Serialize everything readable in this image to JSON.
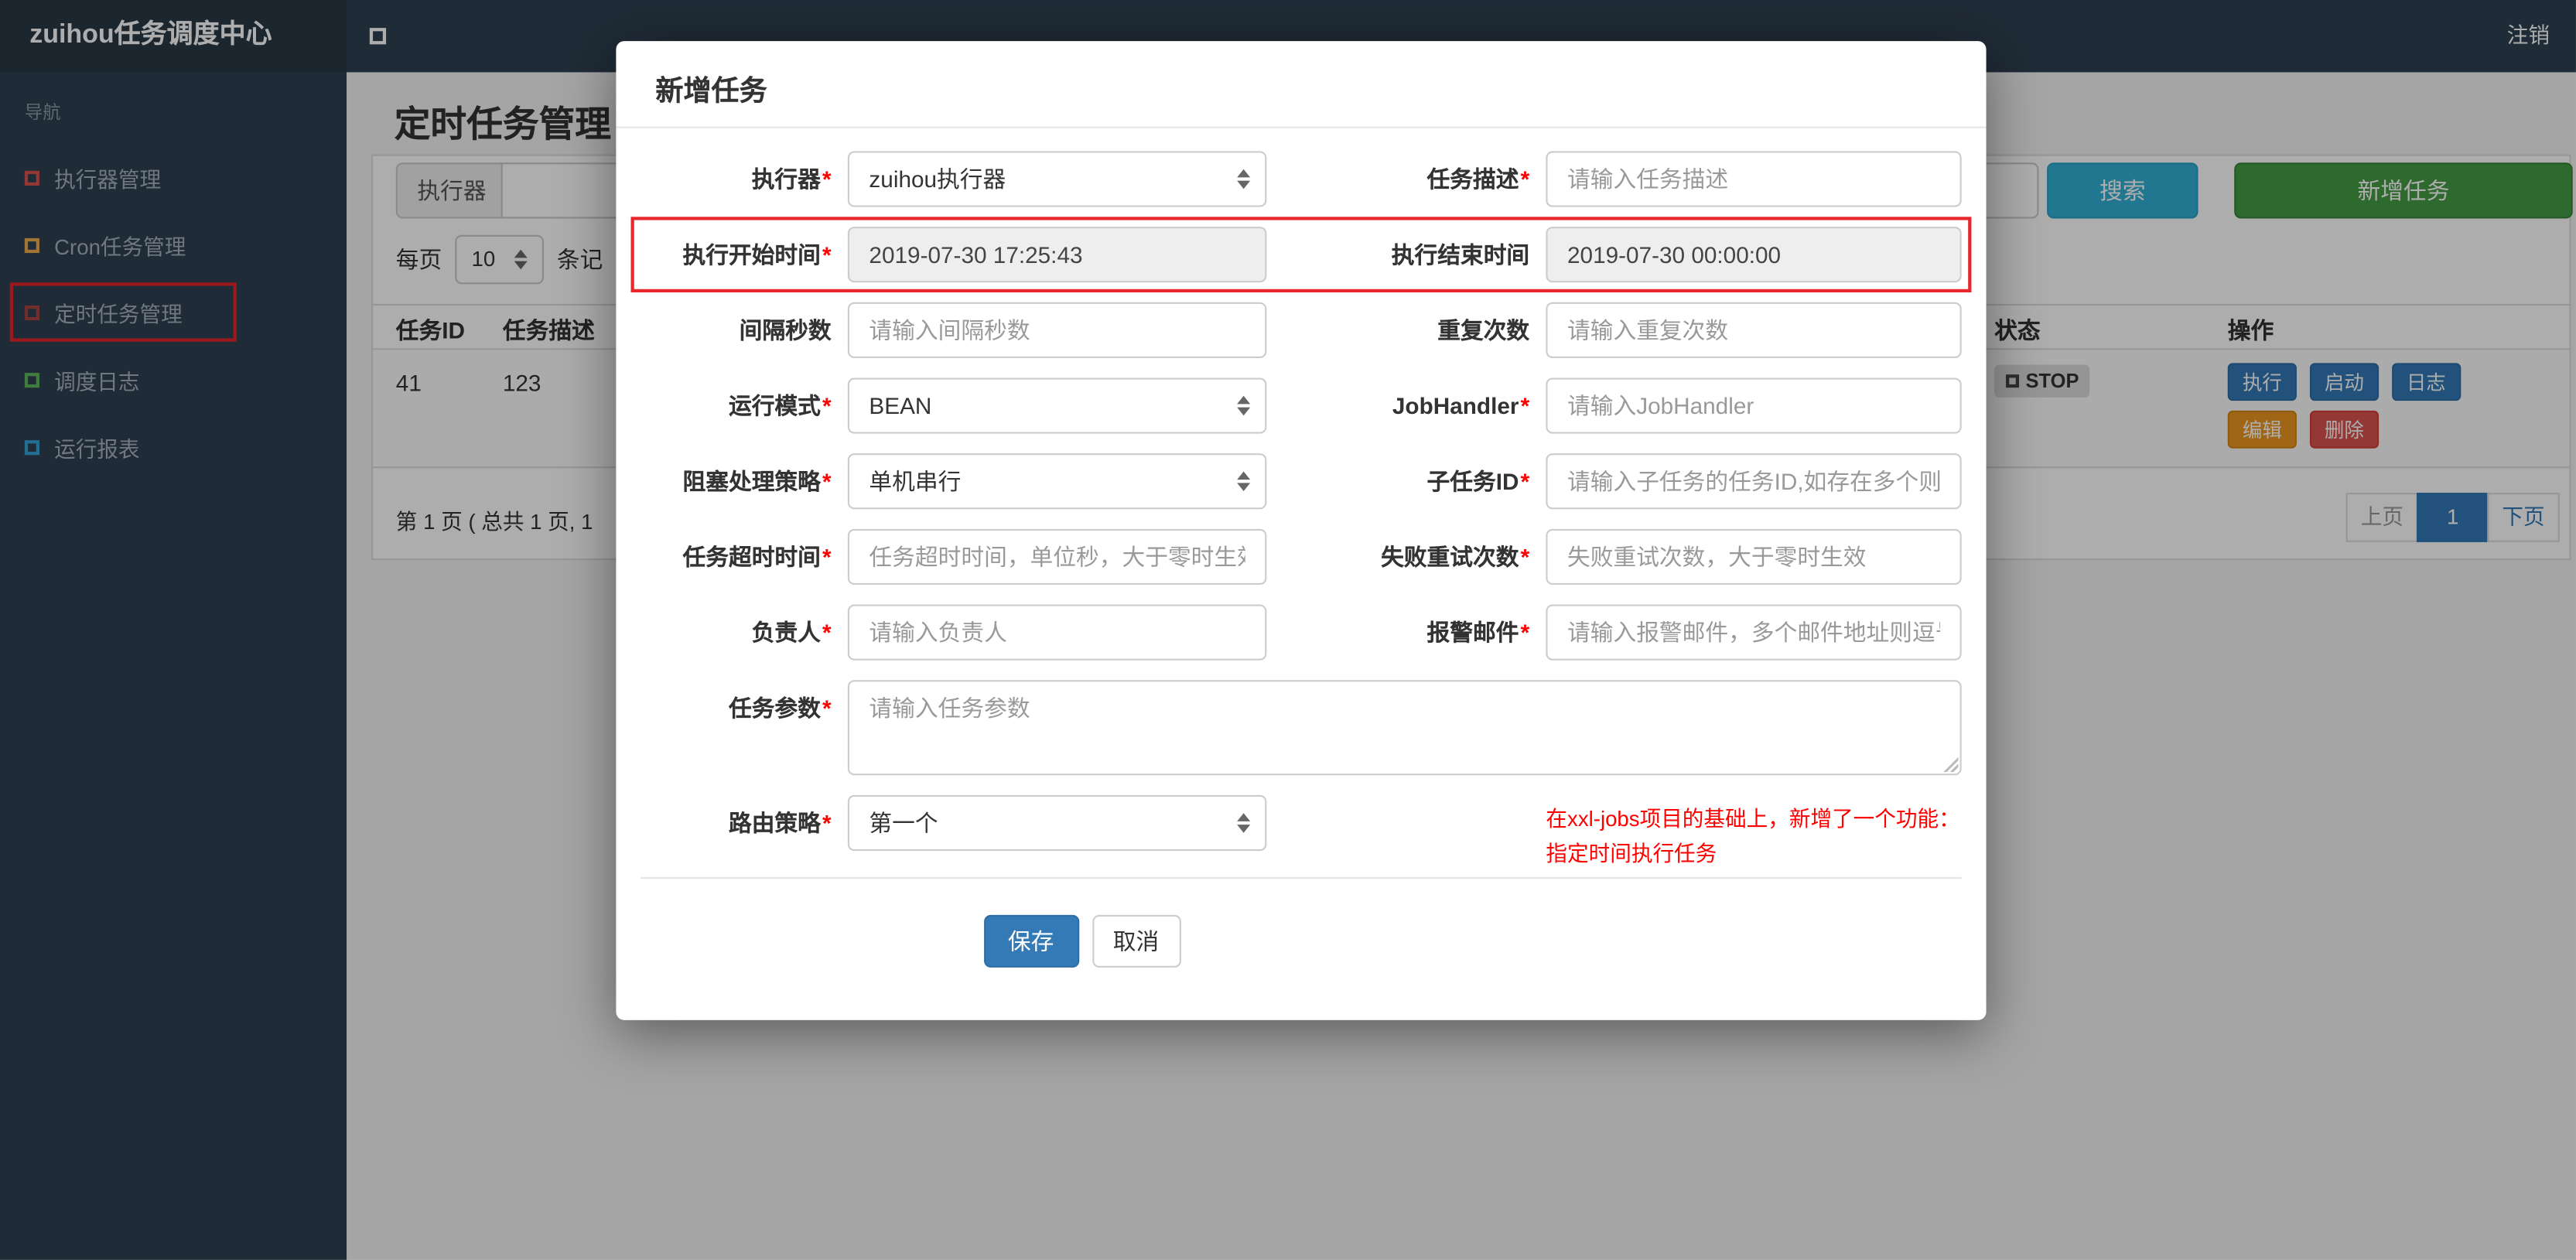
{
  "navbar": {
    "brand": "zuihou任务调度中心",
    "logout_label": "注销"
  },
  "sidebar": {
    "section_header": "导航",
    "items": [
      {
        "label": "执行器管理",
        "icon": "square-outline-icon",
        "icon_color": "#d9534f",
        "annotated": false
      },
      {
        "label": "Cron任务管理",
        "icon": "square-outline-icon",
        "icon_color": "#f0ad4e",
        "annotated": false
      },
      {
        "label": "定时任务管理",
        "icon": "square-outline-icon",
        "icon_color": "#a94442",
        "annotated": true
      },
      {
        "label": "调度日志",
        "icon": "square-outline-icon",
        "icon_color": "#5cb85c",
        "annotated": false
      },
      {
        "label": "运行报表",
        "icon": "square-outline-icon",
        "icon_color": "#36a3d9",
        "annotated": false
      }
    ]
  },
  "page": {
    "title": "定时任务管理",
    "toolbar": {
      "filter_addon": "执行器",
      "search_label": "搜索",
      "add_label": "新增任务"
    },
    "per_page": {
      "prefix": "每页",
      "value": "10",
      "suffix": "条记"
    },
    "table": {
      "headers": [
        "任务ID",
        "任务描述",
        "状态",
        "操作"
      ],
      "row": {
        "job_id": "41",
        "job_desc": "123",
        "status_label": "STOP",
        "actions": [
          "执行",
          "启动",
          "日志",
          "编辑",
          "删除"
        ]
      }
    },
    "pagination": {
      "summary": "第 1 页 ( 总共 1 页, 1",
      "prev_label": "上页",
      "current_page": "1",
      "next_label": "下页"
    }
  },
  "modal": {
    "title": "新增任务",
    "required_marker": "*",
    "fields": {
      "executor": {
        "label": "执行器",
        "value": "zuihou执行器"
      },
      "job_desc": {
        "label": "任务描述",
        "placeholder": "请输入任务描述"
      },
      "start_time": {
        "label": "执行开始时间",
        "value": "2019-07-30 17:25:43"
      },
      "end_time": {
        "label": "执行结束时间",
        "value": "2019-07-30 00:00:00"
      },
      "interval": {
        "label": "间隔秒数",
        "placeholder": "请输入间隔秒数"
      },
      "repeat_count": {
        "label": "重复次数",
        "placeholder": "请输入重复次数"
      },
      "glue_type": {
        "label": "运行模式",
        "value": "BEAN"
      },
      "job_handler": {
        "label": "JobHandler",
        "placeholder": "请输入JobHandler"
      },
      "block_strategy": {
        "label": "阻塞处理策略",
        "value": "单机串行"
      },
      "child_job": {
        "label": "子任务ID",
        "placeholder": "请输入子任务的任务ID,如存在多个则逗"
      },
      "timeout": {
        "label": "任务超时时间",
        "placeholder": "任务超时时间，单位秒，大于零时生效"
      },
      "retry": {
        "label": "失败重试次数",
        "placeholder": "失败重试次数，大于零时生效"
      },
      "owner": {
        "label": "负责人",
        "placeholder": "请输入负责人"
      },
      "alarm_email": {
        "label": "报警邮件",
        "placeholder": "请输入报警邮件，多个邮件地址则逗号分"
      },
      "job_param": {
        "label": "任务参数",
        "placeholder": "请输入任务参数"
      },
      "route_strategy": {
        "label": "路由策略",
        "value": "第一个"
      }
    },
    "note": {
      "line1": "在xxl-jobs项目的基础上，新增了一个功能：",
      "line2": "指定时间执行任务"
    },
    "footer": {
      "save_label": "保存",
      "cancel_label": "取消"
    }
  },
  "colors": {
    "navbar_bg": "#2f4050",
    "brand_bg": "#293846",
    "sidebar_text": "#a7b1c2",
    "search_button": "#31b0d5",
    "add_button": "#449d44",
    "primary_button": "#337ab7",
    "warning_button": "#ec971f",
    "danger_button": "#d9534f",
    "status_chip_bg": "#dcdcdc",
    "annotation_red": "#e8262d",
    "note_red": "#ff0000",
    "required_asterisk": "#ff0000"
  }
}
